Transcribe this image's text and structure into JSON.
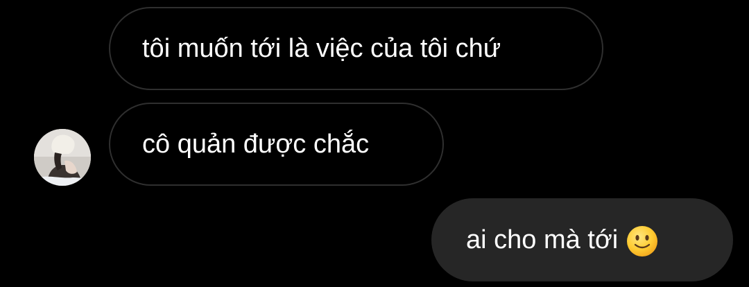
{
  "messages": [
    {
      "direction": "incoming",
      "text": "tôi muốn tới là việc của tôi chứ"
    },
    {
      "direction": "incoming",
      "text": "cô quản được chắc"
    },
    {
      "direction": "outgoing",
      "text": "ai cho mà tới",
      "emoji": "slightly-smiling-face-icon"
    }
  ],
  "colors": {
    "background": "#000000",
    "incoming_border": "#2f2f2f",
    "outgoing_bubble": "#262626",
    "text": "#ffffff",
    "emoji_face": "#ffcc33"
  }
}
